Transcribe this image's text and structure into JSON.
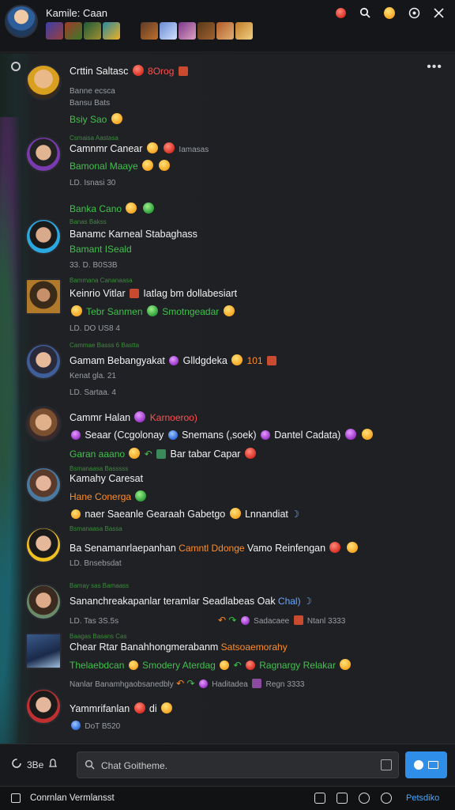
{
  "header": {
    "title": "Kamile: Caan",
    "icons": [
      "notification-icon",
      "search-icon",
      "emoji-icon",
      "settings-icon",
      "close-icon"
    ]
  },
  "chat": {
    "messages": [
      {
        "name": "Crttin Saltasc",
        "badge": "8Orog",
        "line2": "Banne ecsca",
        "line3": "Bansu Bats",
        "status": "Bsiy Sao"
      },
      {
        "tiny": "Csmaisa Aastasa",
        "name": "Camnmr Canear",
        "extra": "Iamasas",
        "status": "Bamonal Maaye",
        "meta": "LD. Isnasi 30"
      },
      {
        "status_top": "Banka Cano",
        "tiny": "Banas Bakss",
        "name": "Banamc Karneal Stabaghass",
        "status": "Bamant ISeald",
        "meta": "33. D. B0S3B"
      },
      {
        "tiny": "Bammana Cananaasa",
        "name": "Keinrio Vitlar",
        "extra": "Iatlag bm dollabesiart",
        "status": "Tebr Sanmen",
        "status2": "Smotngeadar",
        "meta": "LD. DO US8 4"
      },
      {
        "tiny": "Cammae Basss 6 Bastta",
        "name": "Gamam Bebangyakat",
        "tag": "Glldgdeka",
        "num": "101",
        "meta": "Kenat gla. 21",
        "meta2": "LD. Sartaa. 4"
      },
      {
        "name": "Cammr Halan",
        "extra": "Karnoeroo)",
        "row2a": "Seaar (Ccgolonay",
        "row2b": "Snemans (,soek)",
        "row2c": "Dantel Cadata)",
        "row3a": "Garan aaano",
        "row3b": "Bar tabar Capar"
      },
      {
        "tiny": "Bsmanaasa Basssss",
        "name": "Kamahy Caresat",
        "status": "Hane Conerga",
        "row2": "naer Saeanle Gearaah Gabetgo",
        "row2b": "Lnnandiat"
      },
      {
        "tiny": "Bsmanaasa Bassa",
        "name": "Ba Senamanrlaepanhan",
        "orange": "Camntl Ddonge",
        "extra": "Vamo Reinfengan",
        "meta": "LD. Bnsebsdat"
      },
      {
        "tiny": "Bamay sas Bamaass",
        "name": "Sananchreakapanlar teramlar Seadlabeas Oak",
        "blue": "Chal)",
        "meta": "LD. Tas 3S.5s",
        "meta_r1": "Sadacaee",
        "meta_r2": "Ntanl 3333"
      },
      {
        "tiny": "Baagas Basans Cas",
        "name": "Chear Rtar Banahhongmerabanm",
        "orange": "Satsoaemorahy",
        "status": "Thelaebdcan",
        "status2": "Smodery Aterdag",
        "status3": "Ragnargy Relakar",
        "meta": "Nanlar Banamhgaobsanedbly",
        "meta_r1": "Haditadea",
        "meta_r2": "Regn 3333"
      },
      {
        "name": "Yammrifanlan",
        "extra": "di",
        "meta": "DoT B520"
      }
    ]
  },
  "composer": {
    "left_label": "3Be",
    "placeholder": "Chat Goitheme."
  },
  "footer": {
    "label": "Conrnlan Vermlansst",
    "link": "Petsdiko"
  }
}
